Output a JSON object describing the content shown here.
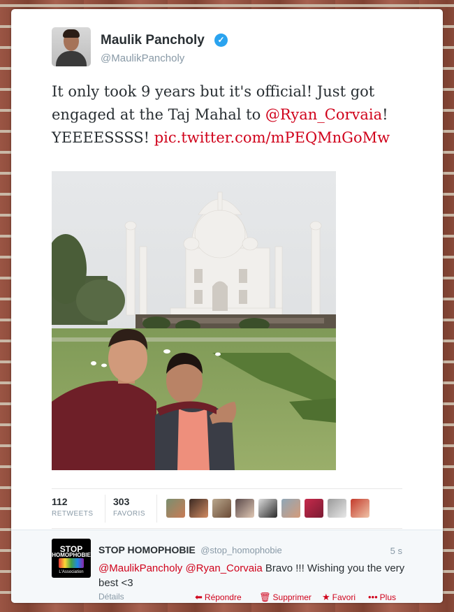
{
  "tweet": {
    "author_name": "Maulik Pancholy",
    "author_handle": "@MaulikPancholy",
    "verified_icon": "verified-badge-icon",
    "text_part1": "It only took 9 years but it's official! Just got engaged at the Taj Mahal to ",
    "mention": "@Ryan_Corvaia",
    "text_part2": "! YEEEESSSS! ",
    "pic_link": "pic.twitter.com/mPEQMnGoMw",
    "photo_icon": "taj-mahal-photo"
  },
  "stats": {
    "retweets_count": "112",
    "retweets_label": "RETWEETS",
    "favorites_count": "303",
    "favorites_label": "FAVORIS"
  },
  "favoriter_avatars": [
    "avatar-1",
    "avatar-2",
    "avatar-3",
    "avatar-4",
    "avatar-5",
    "avatar-6",
    "avatar-7",
    "avatar-8",
    "avatar-9"
  ],
  "reply": {
    "avatar_line1": "STOP",
    "avatar_line2": "HOMOPHOBIE",
    "avatar_line3": "L'Association",
    "name": "STOP HOMOPHOBIE",
    "handle": "@stop_homophobie",
    "time": "5 s",
    "mention1": "@MaulikPancholy",
    "mention2": "@Ryan_Corvaia",
    "text": " Bravo !!! Wishing you the very best <3",
    "details_label": "Détails",
    "actions": {
      "reply_label": "Répondre",
      "delete_label": "Supprimer",
      "favorite_label": "Favori",
      "more_label": "Plus"
    }
  },
  "colors": {
    "link_red": "#d0021b",
    "verified_blue": "#2aa3ef",
    "text_dark": "#292f33",
    "text_grey": "#8899a6"
  }
}
